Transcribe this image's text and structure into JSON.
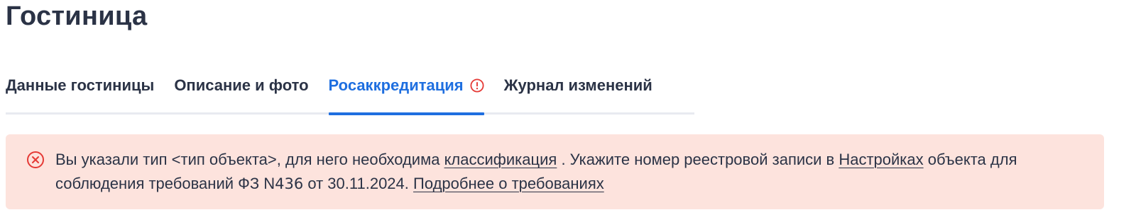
{
  "page": {
    "title": "Гостиница"
  },
  "tabs": [
    {
      "label": "Данные гостиницы",
      "active": false
    },
    {
      "label": "Описание и фото",
      "active": false
    },
    {
      "label": "Росаккредитация",
      "active": true,
      "has_alert": true
    },
    {
      "label": "Журнал изменений",
      "active": false
    }
  ],
  "alert": {
    "icon": "error-circle-x-icon",
    "text_part_1": "Вы указали тип <тип объекта>, для него необходима ",
    "link_classification": "классификация",
    "text_part_2": " . Укажите номер реестровой записи в ",
    "link_settings": "Настройках",
    "text_part_3": " объекта для соблюдения требований ФЗ N",
    "law_number": "436",
    "text_part_4": " от 30.11.2024. ",
    "link_more": "Подробнее о требованиях"
  },
  "colors": {
    "accent": "#1f6fe0",
    "text": "#2b3346",
    "alert_bg": "#fde3dd",
    "error": "#e53935",
    "tab_track": "#e8eaf0"
  }
}
